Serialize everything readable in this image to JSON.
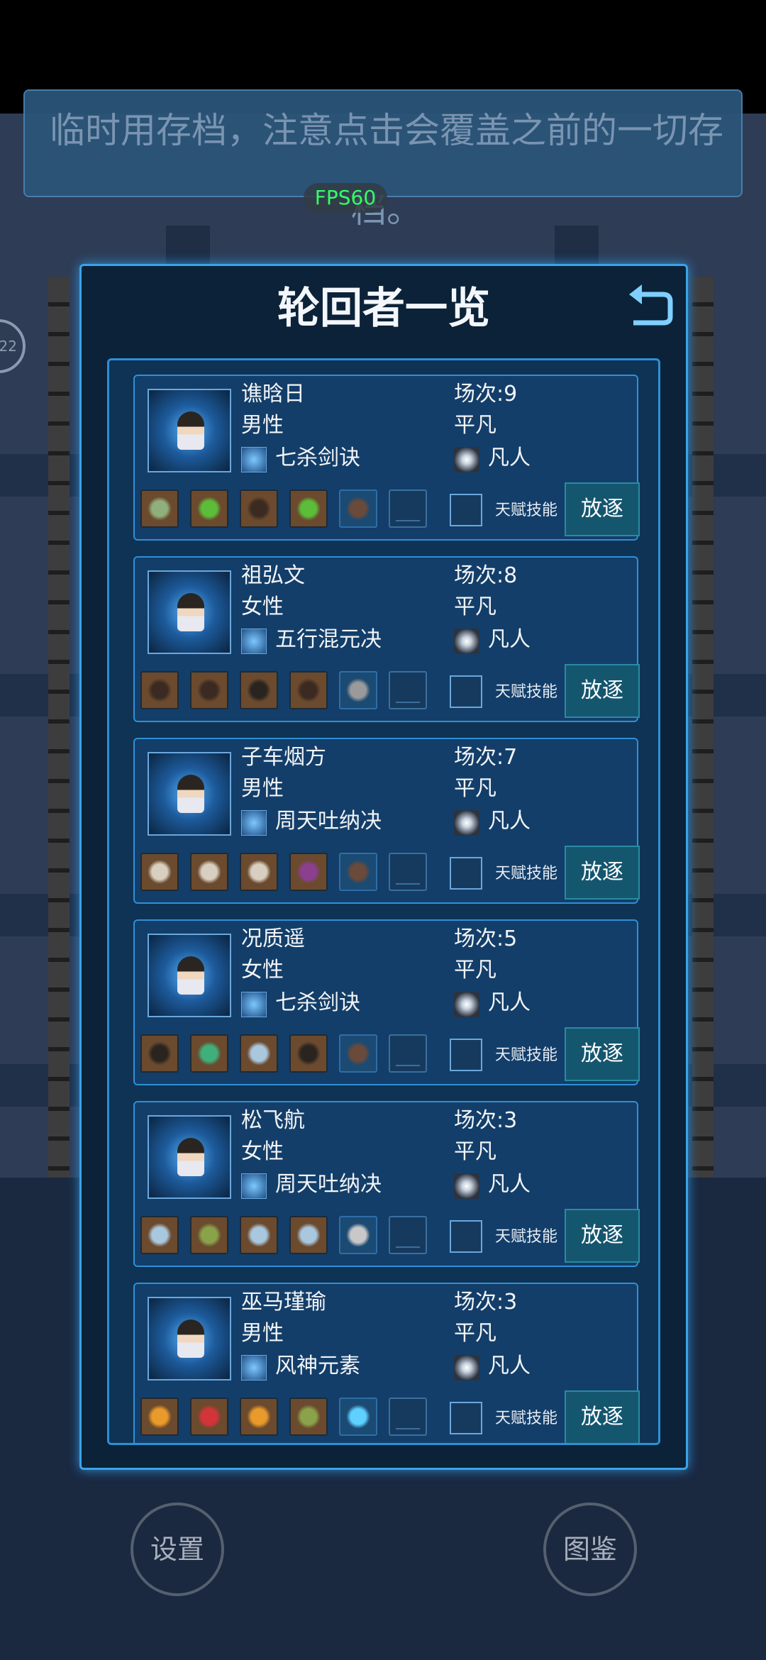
{
  "notice": {
    "text": "临时用存档，注意点击会覆盖之前的一切存档。"
  },
  "fps": "FPS60",
  "side_circle": "22",
  "bottom_buttons": {
    "settings": "设置",
    "codex": "图鉴"
  },
  "panel": {
    "title": "轮回者一览"
  },
  "labels": {
    "talent_skill": "天赋技能",
    "exile": "放逐"
  },
  "characters": [
    {
      "name": "谯晗日",
      "gender": "男性",
      "rounds": "场次:9",
      "grade": "平凡",
      "skill": "七杀剑诀",
      "realm": "凡人",
      "slots": [
        "ring",
        "green-gem",
        "armor",
        "green-gem",
        "gun-rifle",
        "empty"
      ]
    },
    {
      "name": "祖弘文",
      "gender": "女性",
      "rounds": "场次:8",
      "grade": "平凡",
      "skill": "五行混元决",
      "realm": "凡人",
      "slots": [
        "armor",
        "armor",
        "boots",
        "armor",
        "gun-ak",
        "empty"
      ]
    },
    {
      "name": "子车烟方",
      "gender": "男性",
      "rounds": "场次:7",
      "grade": "平凡",
      "skill": "周天吐纳决",
      "realm": "凡人",
      "slots": [
        "shirt",
        "shirt",
        "shirt",
        "purple-grapes",
        "gun-rifle",
        "empty"
      ]
    },
    {
      "name": "况质遥",
      "gender": "女性",
      "rounds": "场次:5",
      "grade": "平凡",
      "skill": "七杀剑诀",
      "realm": "凡人",
      "slots": [
        "boots",
        "green-crystal",
        "blue-crystal",
        "boots",
        "gun-rifle",
        "empty"
      ]
    },
    {
      "name": "松飞航",
      "gender": "女性",
      "rounds": "场次:3",
      "grade": "平凡",
      "skill": "周天吐纳决",
      "realm": "凡人",
      "slots": [
        "blue-crystal",
        "leaf",
        "blue-crystal",
        "blue-crystal",
        "gun-smg",
        "empty"
      ]
    },
    {
      "name": "巫马瑾瑜",
      "gender": "男性",
      "rounds": "场次:3",
      "grade": "平凡",
      "skill": "风神元素",
      "realm": "凡人",
      "slots": [
        "orange-gem",
        "red-gem",
        "orange-gem",
        "leaf",
        "blue-orb",
        "empty"
      ]
    }
  ]
}
